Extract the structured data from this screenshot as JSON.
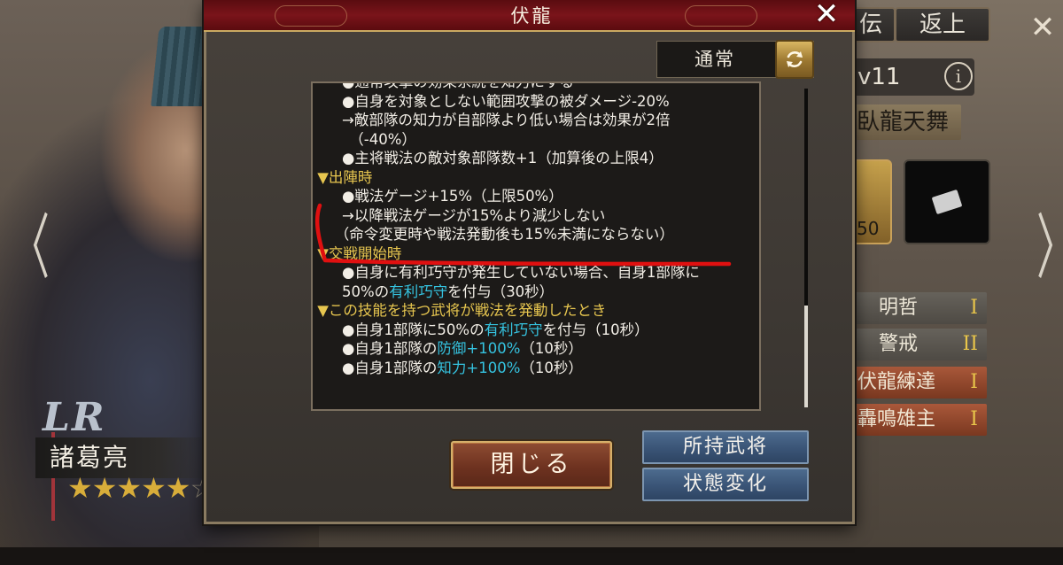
{
  "background": {
    "tabs": {
      "prev_partial": "伝",
      "return": "返上"
    },
    "close_glyph": "✕",
    "level_text": "v11",
    "info_glyph": "i",
    "skill_name_partial": "臥龍天舞",
    "slot_number": "50",
    "nav_left_glyph": "〈",
    "nav_right_glyph": "〉",
    "skill_list": [
      {
        "name": "明哲",
        "level": "I"
      },
      {
        "name": "警戒",
        "level": "II"
      },
      {
        "name": "伏龍練達",
        "level": "I"
      },
      {
        "name": "轟鳴雄主",
        "level": "I"
      }
    ],
    "rarity": "LR",
    "general_name": "諸葛亮",
    "stars_filled": "★★★★★",
    "stars_empty": "☆☆☆"
  },
  "dialog": {
    "title": "伏龍",
    "close_glyph": "✕",
    "mode": "通常",
    "refresh_icon": "refresh-icon",
    "close_button": "閉じる",
    "owned_generals_button": "所持武将",
    "state_change_button": "状態変化",
    "annotation_color": "#e01010",
    "highlight_color": "#35c3e0",
    "section_color": "#e7c64f",
    "text_lines": [
      {
        "pre": "　　●通常攻撃の効果系統を知力にする",
        "hl": "",
        "post": "",
        "section": false
      },
      {
        "pre": "　　●自身を対象としない範囲攻撃の被ダメージ-20%",
        "hl": "",
        "post": "",
        "section": false
      },
      {
        "pre": "　　→敵部隊の知力が自部隊より低い場合は効果が2倍",
        "hl": "",
        "post": "",
        "section": false
      },
      {
        "pre": "　　　（-40%）",
        "hl": "",
        "post": "",
        "section": false
      },
      {
        "pre": "　　●主将戦法の敵対象部隊数+1（加算後の上限4）",
        "hl": "",
        "post": "",
        "section": false
      },
      {
        "pre": " ▼出陣時",
        "hl": "",
        "post": "",
        "section": true
      },
      {
        "pre": "　　●戦法ゲージ+15%（上限50%）",
        "hl": "",
        "post": "",
        "section": false
      },
      {
        "pre": "　　→以降戦法ゲージが15%より減少しない",
        "hl": "",
        "post": "",
        "section": false
      },
      {
        "pre": "　　（命令変更時や戦法発動後も15%未満にならない）",
        "hl": "",
        "post": "",
        "section": false
      },
      {
        "pre": " ▼交戦開始時",
        "hl": "",
        "post": "",
        "section": true
      },
      {
        "pre": "　　●自身に有利巧守が発生していない場合、自身1部隊に",
        "hl": "",
        "post": "",
        "section": false
      },
      {
        "pre": "　　50%の",
        "hl": "有利巧守",
        "post": "を付与（30秒）",
        "section": false
      },
      {
        "pre": " ▼この技能を持つ武将が戦法を発動したとき",
        "hl": "",
        "post": "",
        "section": true
      },
      {
        "pre": "　　●自身1部隊に50%の",
        "hl": "有利巧守",
        "post": "を付与（10秒）",
        "section": false
      },
      {
        "pre": "　　●自身1部隊の",
        "hl": "防御+100%",
        "post": "（10秒）",
        "section": false
      },
      {
        "pre": "　　●自身1部隊の",
        "hl": "知力+100%",
        "post": "（10秒）",
        "section": false
      }
    ]
  }
}
